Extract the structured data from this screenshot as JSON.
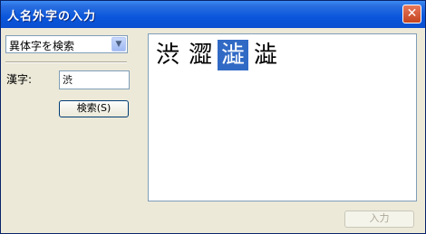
{
  "window": {
    "title": "人名外字の入力",
    "close_label": "✕"
  },
  "search": {
    "mode_selected": "異体字を検索",
    "kanji_label": "漢字:",
    "kanji_value": "渋",
    "search_button": "検索(S)"
  },
  "results": {
    "glyphs": [
      "渋",
      "澀",
      "澁",
      "澁"
    ],
    "selected_index": 2
  },
  "footer": {
    "input_button": "入力",
    "input_enabled": false
  },
  "colors": {
    "title_bar": "#0a56dc",
    "selection": "#316ac5",
    "dialog_bg": "#ece9d8"
  }
}
